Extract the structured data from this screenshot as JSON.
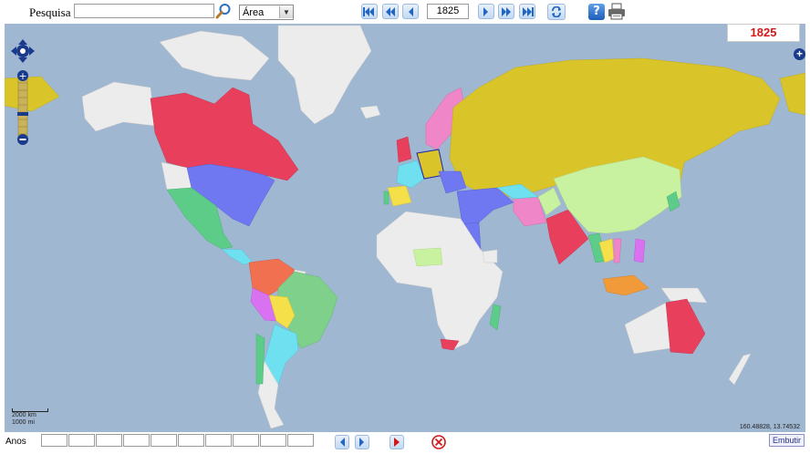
{
  "toolbar": {
    "search_label": "Pesquisa",
    "search_value": "",
    "select_value": "Área",
    "year_value": "1825"
  },
  "map": {
    "year_badge": "1825",
    "coords": "160.48828, 13.74532",
    "scale_km": "2000 km",
    "scale_mi": "1000 mi",
    "layer_plus": "+"
  },
  "bottom": {
    "anos_label": "Anos",
    "anos_cell_count": 10,
    "embed_label": "Embutir"
  },
  "icons": {
    "search": "search-icon",
    "first": "first-icon",
    "prev_fast": "rewind-icon",
    "prev": "previous-icon",
    "next": "next-icon",
    "next_fast": "fast-forward-icon",
    "last": "last-icon",
    "sync": "refresh-icon",
    "help": "help-icon",
    "print": "printer-icon",
    "pan": "pan-arrows-icon",
    "stop": "stop-icon"
  },
  "colors": {
    "ocean": "#9fb7d1",
    "unclaimed_land": "#ececec",
    "russia": "#d9c52a",
    "british_north_america": "#e8405c",
    "united_states": "#6f78f0",
    "mexico": "#5ecc89",
    "brazil": "#7fd08a",
    "ottoman": "#6f78f0",
    "qing": "#c9f2a0",
    "australia": "#e8405c",
    "year_text": "#d01818"
  }
}
